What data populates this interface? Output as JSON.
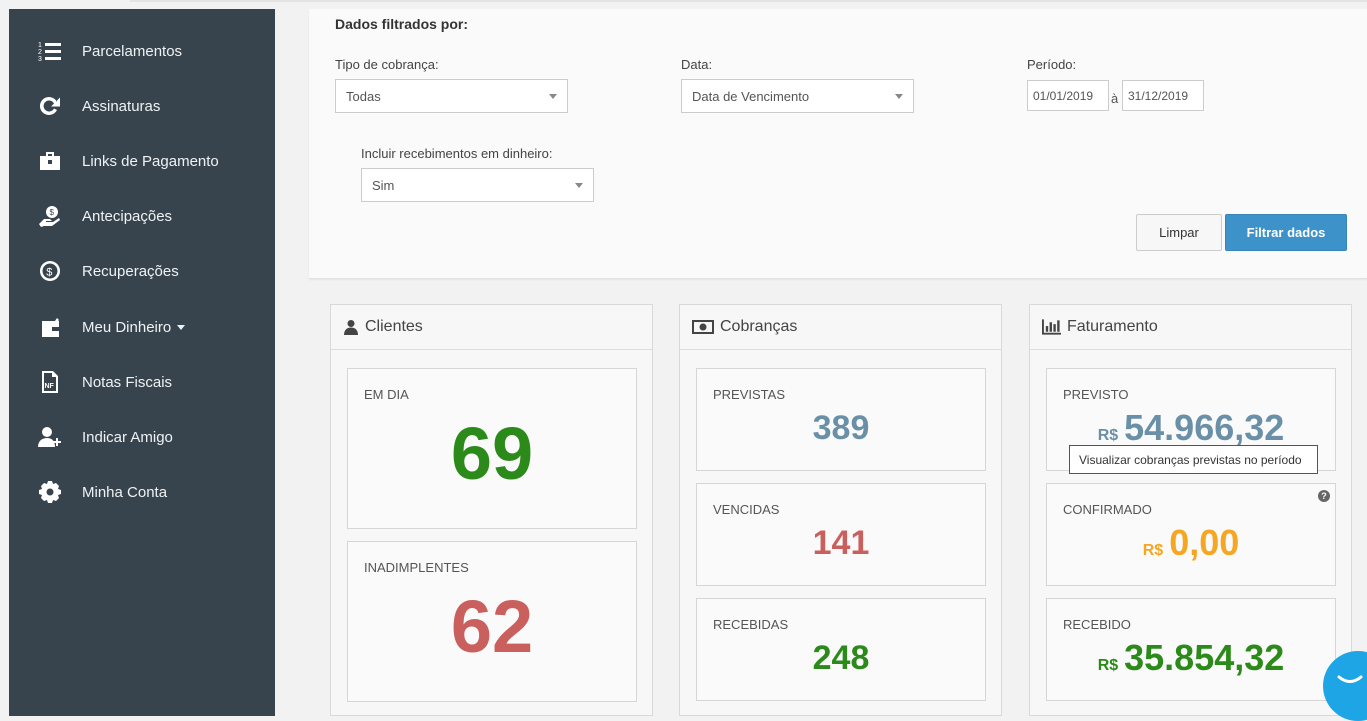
{
  "sidebar": {
    "items": [
      {
        "label": "Parcelamentos",
        "icon": "list-numbered-icon"
      },
      {
        "label": "Assinaturas",
        "icon": "refresh-icon"
      },
      {
        "label": "Links de Pagamento",
        "icon": "briefcase-icon"
      },
      {
        "label": "Antecipações",
        "icon": "hand-money-icon"
      },
      {
        "label": "Recuperações",
        "icon": "dollar-circle-icon"
      },
      {
        "label": "Meu Dinheiro",
        "icon": "wallet-icon"
      },
      {
        "label": "Notas Fiscais",
        "icon": "invoice-icon"
      },
      {
        "label": "Indicar Amigo",
        "icon": "user-plus-icon"
      },
      {
        "label": "Minha Conta",
        "icon": "gear-icon"
      }
    ]
  },
  "filters": {
    "title": "Dados filtrados por:",
    "tipo_label": "Tipo de cobrança:",
    "tipo_value": "Todas",
    "data_label": "Data:",
    "data_value": "Data de Vencimento",
    "periodo_label": "Período:",
    "periodo_start": "01/01/2019",
    "periodo_sep": "à",
    "periodo_end": "31/12/2019",
    "dinheiro_label": "Incluir recebimentos em dinheiro:",
    "dinheiro_value": "Sim",
    "clear_label": "Limpar",
    "filter_label": "Filtrar dados"
  },
  "clientes": {
    "title": "Clientes",
    "icon": "user-icon",
    "em_dia_label": "EM DIA",
    "em_dia_value": "69",
    "inad_label": "INADIMPLENTES",
    "inad_value": "62"
  },
  "cobrancas": {
    "title": "Cobranças",
    "icon": "money-bill-icon",
    "previstas_label": "PREVISTAS",
    "previstas_value": "389",
    "vencidas_label": "VENCIDAS",
    "vencidas_value": "141",
    "recebidas_label": "RECEBIDAS",
    "recebidas_value": "248"
  },
  "faturamento": {
    "title": "Faturamento",
    "icon": "bar-chart-icon",
    "currency": "R$",
    "previsto_label": "PREVISTO",
    "previsto_value": "54.966,32",
    "confirmado_label": "CONFIRMADO",
    "confirmado_value": "0,00",
    "recebido_label": "RECEBIDO",
    "recebido_value": "35.854,32",
    "help": "?"
  },
  "tooltip": "Visualizar cobranças previstas no período",
  "colors": {
    "sidebar": "#38444d",
    "green": "#2b8a1a",
    "red": "#c9605e",
    "blue_gray": "#6a90a8",
    "orange": "#f5a623",
    "primary": "#3d92c9"
  }
}
